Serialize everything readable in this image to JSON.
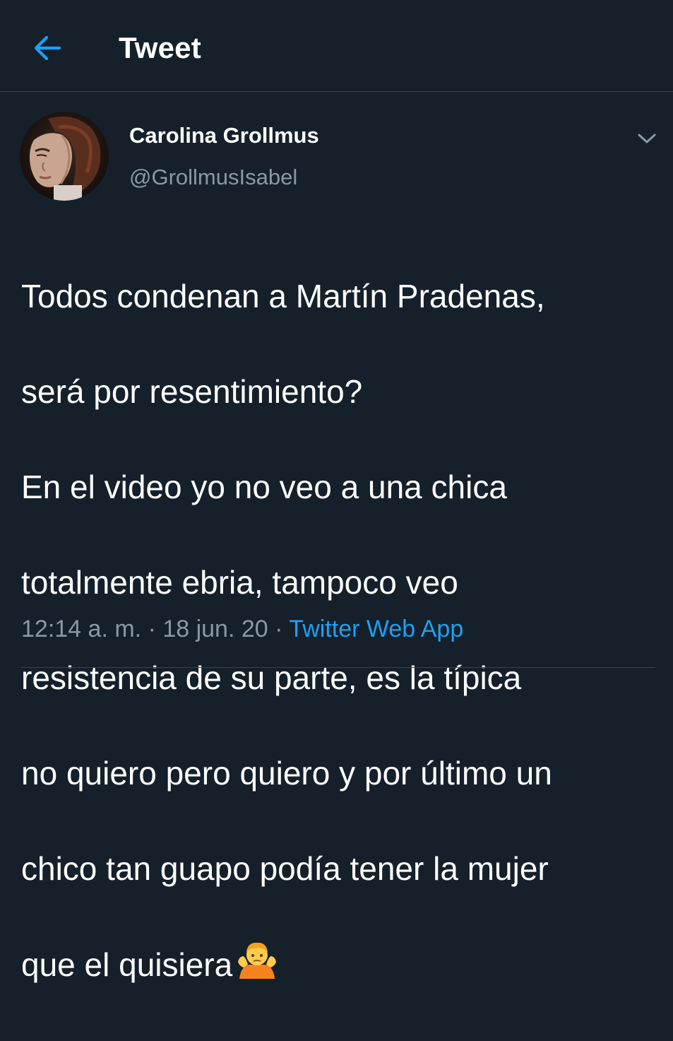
{
  "header": {
    "back_icon": "arrow-left-icon",
    "title": "Tweet"
  },
  "author": {
    "display_name": "Carolina Grollmus",
    "handle": "@GrollmusIsabel",
    "avatar_alt": "avatar-photo"
  },
  "tweet": {
    "text_lines": [
      "Todos condenan a Martín Pradenas,",
      "será por resentimiento?",
      "En el video yo no veo a una chica",
      "totalmente ebria, tampoco veo",
      "resistencia de su parte, es la típica",
      "no quiero pero quiero y por último un",
      "chico tan guapo podía tener la mujer",
      "que el quisiera"
    ],
    "emoji": "person-shrugging-emoji"
  },
  "meta": {
    "time": "12:14 a. m.",
    "sep1": " · ",
    "date": "18 jun. 20",
    "sep2": " · ",
    "source": "Twitter Web App"
  },
  "colors": {
    "background": "#15202b",
    "accent": "#1da1f2",
    "secondary_text": "#8899a6",
    "divider": "#38444d"
  },
  "icons": {
    "more": "chevron-down-icon"
  }
}
